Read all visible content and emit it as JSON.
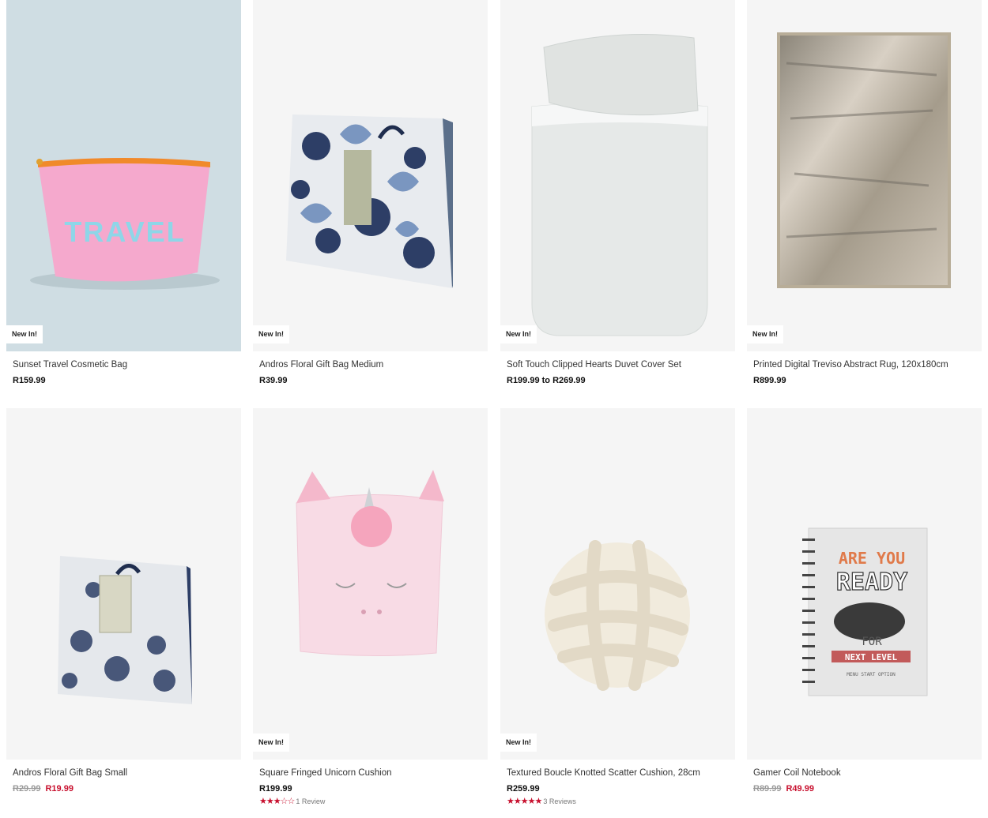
{
  "products": [
    {
      "name": "Sunset Travel Cosmetic Bag",
      "badge": "New In!",
      "price": "R159.99",
      "image_text": "TRAVEL"
    },
    {
      "name": "Andros Floral Gift Bag Medium",
      "badge": "New In!",
      "price": "R39.99"
    },
    {
      "name": "Soft Touch Clipped Hearts Duvet Cover Set",
      "badge": "New In!",
      "price": "R199.99 to R269.99"
    },
    {
      "name": "Printed Digital Treviso Abstract Rug, 120x180cm",
      "badge": "New In!",
      "price": "R899.99"
    },
    {
      "name": "Andros Floral Gift Bag Small",
      "was_price": "R29.99",
      "sale_price": "R19.99"
    },
    {
      "name": "Square Fringed Unicorn Cushion",
      "badge": "New In!",
      "price": "R199.99",
      "rating": 3,
      "stars": "★★★☆☆",
      "reviews": "1 Review"
    },
    {
      "name": "Textured Boucle Knotted Scatter Cushion, 28cm",
      "badge": "New In!",
      "price": "R259.99",
      "rating": 5,
      "stars": "★★★★★",
      "reviews": "3 Reviews"
    },
    {
      "name": "Gamer Coil Notebook",
      "was_price": "R89.99",
      "sale_price": "R49.99",
      "image_text": [
        "ARE YOU",
        "READY",
        "FOR",
        "NEXT LEVEL",
        "MENU START OPTION"
      ]
    }
  ],
  "colors": {
    "sale": "#c8102e",
    "was": "#999999",
    "tile_bg": "#f5f5f5"
  }
}
